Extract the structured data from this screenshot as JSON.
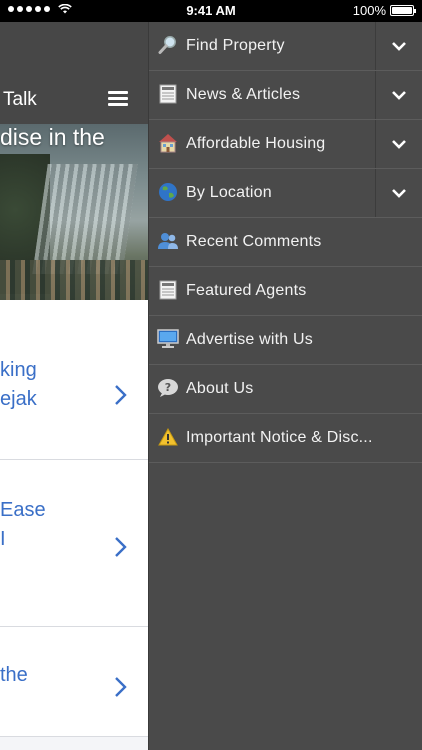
{
  "status": {
    "time": "9:41 AM",
    "battery": "100%"
  },
  "app": {
    "title": "Talk"
  },
  "hero": {
    "headline": "dise in the"
  },
  "articles": [
    {
      "lines": [
        "king",
        "ejak"
      ]
    },
    {
      "lines": [
        "Ease",
        "I"
      ]
    },
    {
      "lines": [
        "the"
      ]
    }
  ],
  "menu": [
    {
      "label": "Find Property",
      "icon": "magnifier-icon",
      "expandable": true
    },
    {
      "label": "News & Articles",
      "icon": "newspaper-icon",
      "expandable": true
    },
    {
      "label": "Affordable Housing",
      "icon": "house-icon",
      "expandable": true
    },
    {
      "label": "By Location",
      "icon": "globe-icon",
      "expandable": true
    },
    {
      "label": "Recent Comments",
      "icon": "users-icon",
      "expandable": false
    },
    {
      "label": "Featured Agents",
      "icon": "document-icon",
      "expandable": false
    },
    {
      "label": "Advertise with Us",
      "icon": "monitor-icon",
      "expandable": false
    },
    {
      "label": "About Us",
      "icon": "help-bubble-icon",
      "expandable": false
    },
    {
      "label": "Important Notice & Disc...",
      "icon": "warning-icon",
      "expandable": false
    }
  ],
  "colors": {
    "drawer_bg": "#4a4a4a",
    "link_blue": "#3a6fc7",
    "header_bg": "#474747"
  }
}
